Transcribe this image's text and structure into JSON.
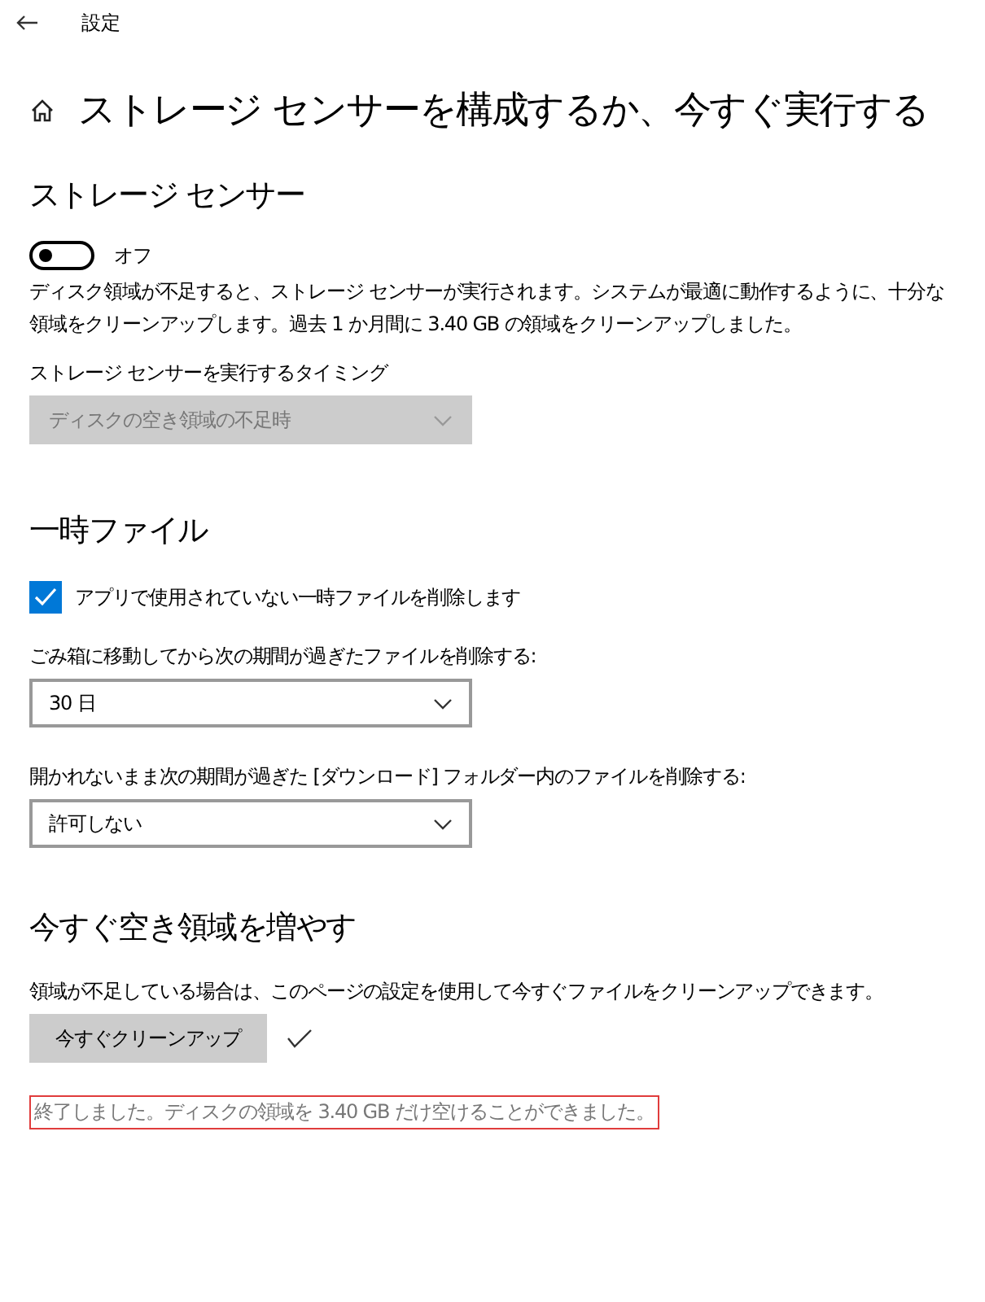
{
  "window": {
    "title": "設定"
  },
  "page_title": "ストレージ センサーを構成するか、今すぐ実行する",
  "storage_sense": {
    "heading": "ストレージ センサー",
    "toggle": {
      "on": false,
      "label": "オフ"
    },
    "description": "ディスク領域が不足すると、ストレージ センサーが実行されます。システムが最適に動作するように、十分な領域をクリーンアップします。過去 1 か月間に 3.40 GB の領域をクリーンアップしました。",
    "timing_label": "ストレージ センサーを実行するタイミング",
    "timing_dropdown": {
      "value": "ディスクの空き領域の不足時",
      "disabled": true
    }
  },
  "temp_files": {
    "heading": "一時ファイル",
    "checkbox": {
      "label": "アプリで使用されていない一時ファイルを削除します",
      "checked": true
    },
    "settings": [
      {
        "label": "ごみ箱に移動してから次の期間が過ぎたファイルを削除する:",
        "value": "30 日",
        "disabled": false
      },
      {
        "label": "開かれないまま次の期間が過ぎた [ダウンロード] フォルダー内のファイルを削除する:",
        "value": "許可しない",
        "disabled": false
      }
    ]
  },
  "free_up": {
    "heading": "今すぐ空き領域を増やす",
    "description": "領域が不足している場合は、このページの設定を使用して今すぐファイルをクリーンアップできます。",
    "button": "今すぐクリーンアップ",
    "completed": true,
    "status": {
      "text": "終了しました。ディスクの領域を 3.40 GB だけ空けることができました。",
      "highlighted": true
    }
  }
}
